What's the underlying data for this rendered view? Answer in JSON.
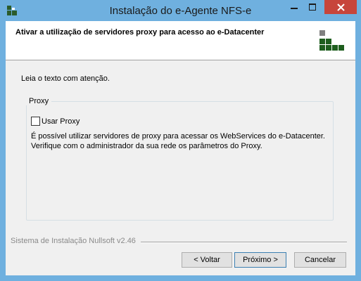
{
  "window": {
    "title": "Instalação do e-Agente NFS-e",
    "icons": {
      "app": "installer-icon",
      "minimize": "minimize-icon",
      "maximize": "maximize-icon",
      "close": "close-icon"
    }
  },
  "header": {
    "title": "Ativar a utilização de servidores proxy para acesso ao e-Datacenter",
    "logo_icon": "green-grid-logo"
  },
  "body": {
    "instruction": "Leia o texto com atenção.",
    "group": {
      "label": "Proxy",
      "checkbox_label": "Usar Proxy",
      "checkbox_checked": false,
      "description": "É possível utilizar servidores de proxy para acessar os WebServices do e-Datacenter. Verifique com o administrador da sua rede os parâmetros do Proxy."
    }
  },
  "footer": {
    "branding": "Sistema de Instalação Nullsoft v2.46",
    "buttons": {
      "back": "< Voltar",
      "next": "Próximo >",
      "cancel": "Cancelar"
    }
  },
  "colors": {
    "title_bar": "#6fb0df",
    "close_button": "#c7453b",
    "logo_green": "#1e5e1e",
    "logo_gray": "#808080",
    "dialog_bg": "#f0f0f0"
  }
}
